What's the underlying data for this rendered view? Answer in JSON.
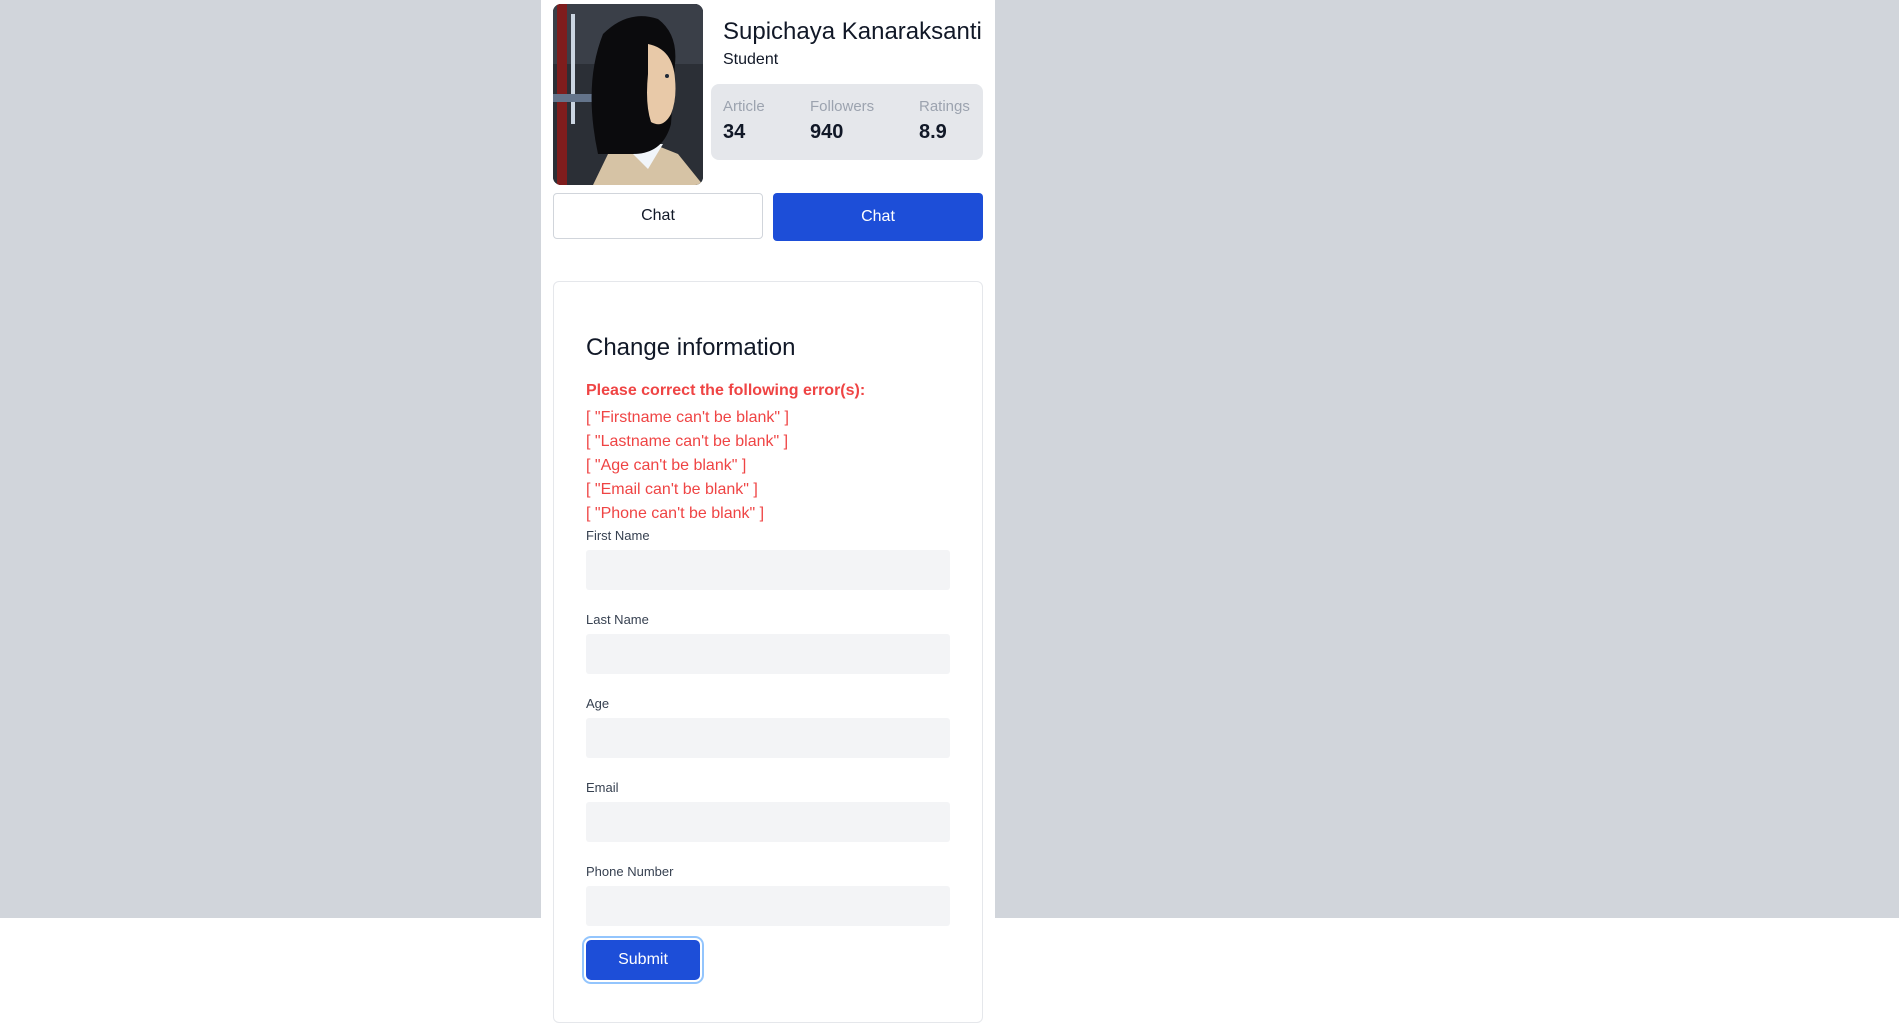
{
  "profile": {
    "name": "Supichaya Kanaraksanti",
    "role": "Student",
    "stats": [
      {
        "label": "Article",
        "value": "34"
      },
      {
        "label": "Followers",
        "value": "940"
      },
      {
        "label": "Ratings",
        "value": "8.9"
      }
    ],
    "buttons": {
      "chat_outline": "Chat",
      "chat_primary": "Chat"
    }
  },
  "form": {
    "title": "Change information",
    "error_heading": "Please correct the following error(s):",
    "errors": [
      "[ \"Firstname can't be blank\" ]",
      "[ \"Lastname can't be blank\" ]",
      "[ \"Age can't be blank\" ]",
      "[ \"Email can't be blank\" ]",
      "[ \"Phone can't be blank\" ]"
    ],
    "fields": [
      {
        "label": "First Name",
        "value": ""
      },
      {
        "label": "Last Name",
        "value": ""
      },
      {
        "label": "Age",
        "value": ""
      },
      {
        "label": "Email",
        "value": ""
      },
      {
        "label": "Phone Number",
        "value": ""
      }
    ],
    "submit_label": "Submit"
  },
  "colors": {
    "page_bg": "#d1d5db",
    "primary": "#1d4ed8",
    "error": "#ef4444",
    "input_bg": "#f3f4f6"
  }
}
